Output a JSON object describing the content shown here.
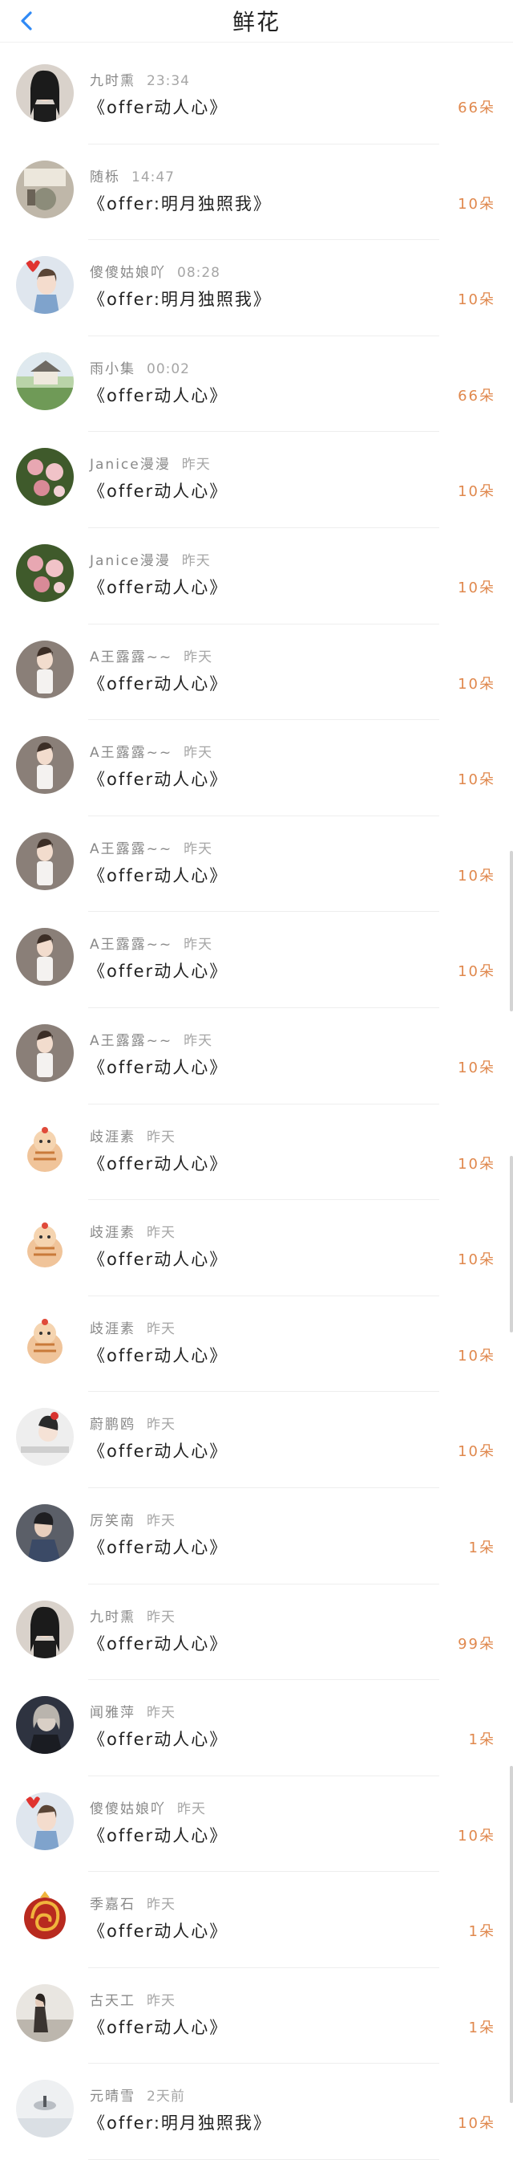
{
  "header": {
    "title": "鲜花"
  },
  "rows": [
    {
      "name": "九时熏",
      "time": "23:34",
      "gift": "《offer动人心》",
      "amount": "66朵"
    },
    {
      "name": "随栎",
      "time": "14:47",
      "gift": "《offer:明月独照我》",
      "amount": "10朵"
    },
    {
      "name": "傻傻姑娘吖",
      "time": "08:28",
      "gift": "《offer:明月独照我》",
      "amount": "10朵"
    },
    {
      "name": "雨小集",
      "time": "00:02",
      "gift": "《offer动人心》",
      "amount": "66朵"
    },
    {
      "name": "Janice漫漫",
      "time": "昨天",
      "gift": "《offer动人心》",
      "amount": "10朵"
    },
    {
      "name": "Janice漫漫",
      "time": "昨天",
      "gift": "《offer动人心》",
      "amount": "10朵"
    },
    {
      "name": "A王露露~~",
      "time": "昨天",
      "gift": "《offer动人心》",
      "amount": "10朵"
    },
    {
      "name": "A王露露~~",
      "time": "昨天",
      "gift": "《offer动人心》",
      "amount": "10朵"
    },
    {
      "name": "A王露露~~",
      "time": "昨天",
      "gift": "《offer动人心》",
      "amount": "10朵"
    },
    {
      "name": "A王露露~~",
      "time": "昨天",
      "gift": "《offer动人心》",
      "amount": "10朵"
    },
    {
      "name": "A王露露~~",
      "time": "昨天",
      "gift": "《offer动人心》",
      "amount": "10朵"
    },
    {
      "name": "歧涯素",
      "time": "昨天",
      "gift": "《offer动人心》",
      "amount": "10朵"
    },
    {
      "name": "歧涯素",
      "time": "昨天",
      "gift": "《offer动人心》",
      "amount": "10朵"
    },
    {
      "name": "歧涯素",
      "time": "昨天",
      "gift": "《offer动人心》",
      "amount": "10朵"
    },
    {
      "name": "蔚鹏鸥",
      "time": "昨天",
      "gift": "《offer动人心》",
      "amount": "10朵"
    },
    {
      "name": "厉笑南",
      "time": "昨天",
      "gift": "《offer动人心》",
      "amount": "1朵"
    },
    {
      "name": "九时熏",
      "time": "昨天",
      "gift": "《offer动人心》",
      "amount": "99朵"
    },
    {
      "name": "闻雅萍",
      "time": "昨天",
      "gift": "《offer动人心》",
      "amount": "1朵"
    },
    {
      "name": "傻傻姑娘吖",
      "time": "昨天",
      "gift": "《offer动人心》",
      "amount": "10朵"
    },
    {
      "name": "季嘉石",
      "time": "昨天",
      "gift": "《offer动人心》",
      "amount": "1朵"
    },
    {
      "name": "古天工",
      "time": "昨天",
      "gift": "《offer动人心》",
      "amount": "1朵"
    },
    {
      "name": "元晴雪",
      "time": "2天前",
      "gift": "《offer:明月独照我》",
      "amount": "10朵"
    }
  ],
  "colors": {
    "accent_blue": "#2f89f5",
    "amount_orange": "#e0884d",
    "name_gray": "#888888"
  },
  "icons": {
    "back": "chevron-left-icon"
  }
}
